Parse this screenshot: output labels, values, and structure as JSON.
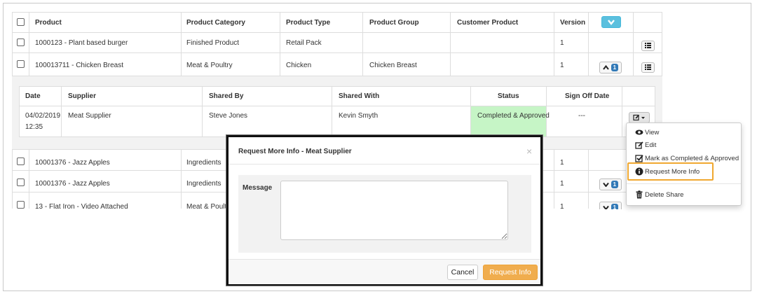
{
  "products_table": {
    "headers": [
      "Product",
      "Product Category",
      "Product Type",
      "Product Group",
      "Customer Product",
      "Version"
    ],
    "rows_top": [
      {
        "product": "1000123 - Plant based burger",
        "category": "Finished Product",
        "type": "Retail Pack",
        "group": "",
        "customer": "",
        "version": "1"
      },
      {
        "product": "100013711 - Chicken Breast",
        "category": "Meat & Poultry",
        "type": "Chicken",
        "group": "Chicken Breast",
        "customer": "",
        "version": "1",
        "badge": "1"
      }
    ],
    "rows_bottom": [
      {
        "product": "10001376 - Jazz Apples",
        "category": "Ingredients",
        "version": "1"
      },
      {
        "product": "10001376 - Jazz Apples",
        "category": "Ingredients",
        "version": "1",
        "badge": "1"
      },
      {
        "product": "13 - Flat Iron - Video Attached",
        "category": "Meat & Poultry",
        "version": "1",
        "badge": "1"
      }
    ]
  },
  "shares_table": {
    "headers": {
      "date": "Date",
      "supplier": "Supplier",
      "shared_by": "Shared By",
      "shared_with": "Shared With",
      "status": "Status",
      "sign_off": "Sign Off Date"
    },
    "row": {
      "date": "04/02/2019",
      "time": "12:35",
      "supplier": "Meat Supplier",
      "shared_by": "Steve Jones",
      "shared_with": "Kevin Smyth",
      "status": "Completed & Approved",
      "sign_off": "---"
    },
    "status_color": "#c6f5c6"
  },
  "action_menu": {
    "items": [
      {
        "label": "View",
        "icon": "eye-icon"
      },
      {
        "label": "Edit",
        "icon": "edit-icon"
      },
      {
        "label": "Mark as Completed & Approved",
        "icon": "check-square-icon"
      },
      {
        "label": "Request More Info",
        "icon": "info-circle-icon"
      },
      {
        "label": "Delete Share",
        "icon": "trash-icon"
      }
    ],
    "highlight_color": "#f0a830"
  },
  "modal": {
    "title": "Request More Info - Meat Supplier",
    "close": "×",
    "message_label": "Message",
    "message_value": "",
    "cancel_label": "Cancel",
    "submit_label": "Request Info",
    "submit_color": "#f0ad4e"
  }
}
